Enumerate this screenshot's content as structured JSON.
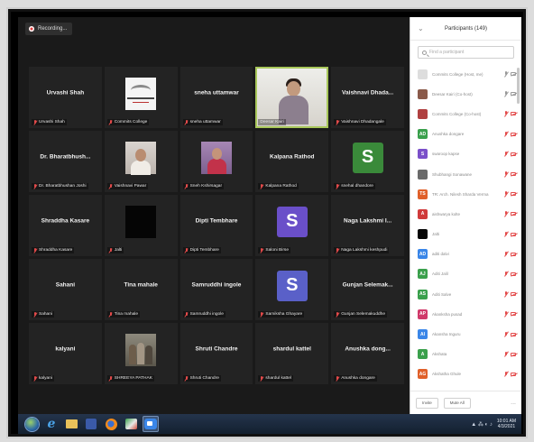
{
  "recording": {
    "label": "Recording..."
  },
  "tiles": [
    {
      "kind": "name",
      "title": "Urvashi Shah",
      "label": "Urvashi Shah"
    },
    {
      "kind": "photo",
      "photo": "logo",
      "label": "Commits College"
    },
    {
      "kind": "name",
      "title": "sneha uttamwar",
      "label": "sneha uttamwar"
    },
    {
      "kind": "video",
      "label": "Deesar Kairi",
      "active": true
    },
    {
      "kind": "name",
      "title": "Vaishnavi Dhada...",
      "label": "Vaishnavi Dhadangale"
    },
    {
      "kind": "name",
      "title": "Dr. Bharatbhush...",
      "label": "Dr. Bharatbhushan Joshi"
    },
    {
      "kind": "photo",
      "photo": "portrait-1",
      "label": "Vaishnavi Pawar"
    },
    {
      "kind": "photo",
      "photo": "portrait-2",
      "label": "Sneh Kshirsagar"
    },
    {
      "kind": "name",
      "title": "Kalpana Rathod",
      "label": "Kalpana Rathod"
    },
    {
      "kind": "avatar",
      "letter": "S",
      "color": "#3a8a3a",
      "label": "snehal dhandore"
    },
    {
      "kind": "name",
      "title": "Shraddha Kasare",
      "label": "Shraddha Kasare"
    },
    {
      "kind": "photo",
      "photo": "dark",
      "label": "Jalti"
    },
    {
      "kind": "name",
      "title": "Dipti Tembhare",
      "label": "Dipti Tembhare"
    },
    {
      "kind": "avatar",
      "letter": "S",
      "color": "#6a4fc9",
      "label": "Saloni Birse"
    },
    {
      "kind": "name",
      "title": "Naga Lakshmi I...",
      "label": "Naga Lakshmi keshpudi"
    },
    {
      "kind": "name",
      "title": "Sahani",
      "label": "Sahani"
    },
    {
      "kind": "name",
      "title": "Tina mahale",
      "label": "Tina mahale"
    },
    {
      "kind": "name",
      "title": "Samruddhi ingole",
      "label": "Samruddhi ingole"
    },
    {
      "kind": "avatar",
      "letter": "S",
      "color": "#5a60c8",
      "label": "Samiksha Ghayare"
    },
    {
      "kind": "name",
      "title": "Gunjan Selemak...",
      "label": "Gunjan Selemakuddhe"
    },
    {
      "kind": "name",
      "title": "kalyani",
      "label": "kalyani"
    },
    {
      "kind": "photo",
      "photo": "group",
      "label": "SHREEYA PATHAK"
    },
    {
      "kind": "name",
      "title": "Shruti Chandre",
      "label": "Shruti Chandre"
    },
    {
      "kind": "name",
      "title": "shardul kattel",
      "label": "shardul kattel"
    },
    {
      "kind": "name",
      "title": "Anushka dong...",
      "label": "Anushka dongare"
    }
  ],
  "panel": {
    "title": "Participants (149)",
    "search_placeholder": "Find a participant",
    "participants": [
      {
        "name": "Commits College (Host, me)",
        "avatar": "logo",
        "color": "#dddddd",
        "initials": "",
        "mic": "gray",
        "cam": "gray"
      },
      {
        "name": "Deesar Kairi (Co-host)",
        "avatar": "photo",
        "color": "#8a5a4a",
        "initials": "",
        "mic": "gray",
        "cam": "gray"
      },
      {
        "name": "Commits College (Co-host)",
        "avatar": "photo",
        "color": "#b04040",
        "initials": "",
        "mic": "red",
        "cam": "red"
      },
      {
        "name": "Anushka dongare",
        "avatar": "initials",
        "color": "#3aa04c",
        "initials": "AD",
        "mic": "red",
        "cam": "red"
      },
      {
        "name": "swaroop kapse",
        "avatar": "initials",
        "color": "#7a4fc9",
        "initials": "S",
        "mic": "red",
        "cam": "red"
      },
      {
        "name": "Shubhangi Sonawane",
        "avatar": "photo",
        "color": "#6a6a6a",
        "initials": "",
        "mic": "red",
        "cam": "red"
      },
      {
        "name": "TR: Arch. Nilesh Sharda Verma",
        "avatar": "initials",
        "color": "#e0602a",
        "initials": "TS",
        "mic": "red",
        "cam": "red"
      },
      {
        "name": "aishwarya kolte",
        "avatar": "initials",
        "color": "#d03a3a",
        "initials": "A",
        "mic": "red",
        "cam": "red"
      },
      {
        "name": "Jalti",
        "avatar": "photo",
        "color": "#050505",
        "initials": "",
        "mic": "red",
        "cam": "red"
      },
      {
        "name": "aditi dalvi",
        "avatar": "initials",
        "color": "#3a86e8",
        "initials": "AD",
        "mic": "red",
        "cam": "red"
      },
      {
        "name": "Aditi Jalil",
        "avatar": "initials",
        "color": "#3aa04c",
        "initials": "AJ",
        "mic": "red",
        "cam": "red"
      },
      {
        "name": "Aditi Salve",
        "avatar": "initials",
        "color": "#3aa04c",
        "initials": "AS",
        "mic": "red",
        "cam": "red"
      },
      {
        "name": "Akanksha pusad",
        "avatar": "initials",
        "color": "#d03a6a",
        "initials": "AP",
        "mic": "red",
        "cam": "red"
      },
      {
        "name": "Akansha Inguru",
        "avatar": "initials",
        "color": "#3a86e8",
        "initials": "AI",
        "mic": "red",
        "cam": "red"
      },
      {
        "name": "Akshata",
        "avatar": "initials",
        "color": "#3aa04c",
        "initials": "A",
        "mic": "red",
        "cam": "red"
      },
      {
        "name": "Akshatha Ghule",
        "avatar": "initials",
        "color": "#e0602a",
        "initials": "AG",
        "mic": "red",
        "cam": "red"
      }
    ],
    "invite_label": "Invite",
    "mute_all_label": "Mute All",
    "more_label": "..."
  },
  "taskbar": {
    "icons": [
      "windows-start-icon",
      "internet-explorer-icon",
      "folder-icon",
      "media-player-icon",
      "firefox-icon",
      "paint-icon",
      "zoom-icon"
    ],
    "tray_text": "▲ ⁂ ◐ ♪",
    "time": "10:01 AM",
    "date": "4/3/2021"
  }
}
